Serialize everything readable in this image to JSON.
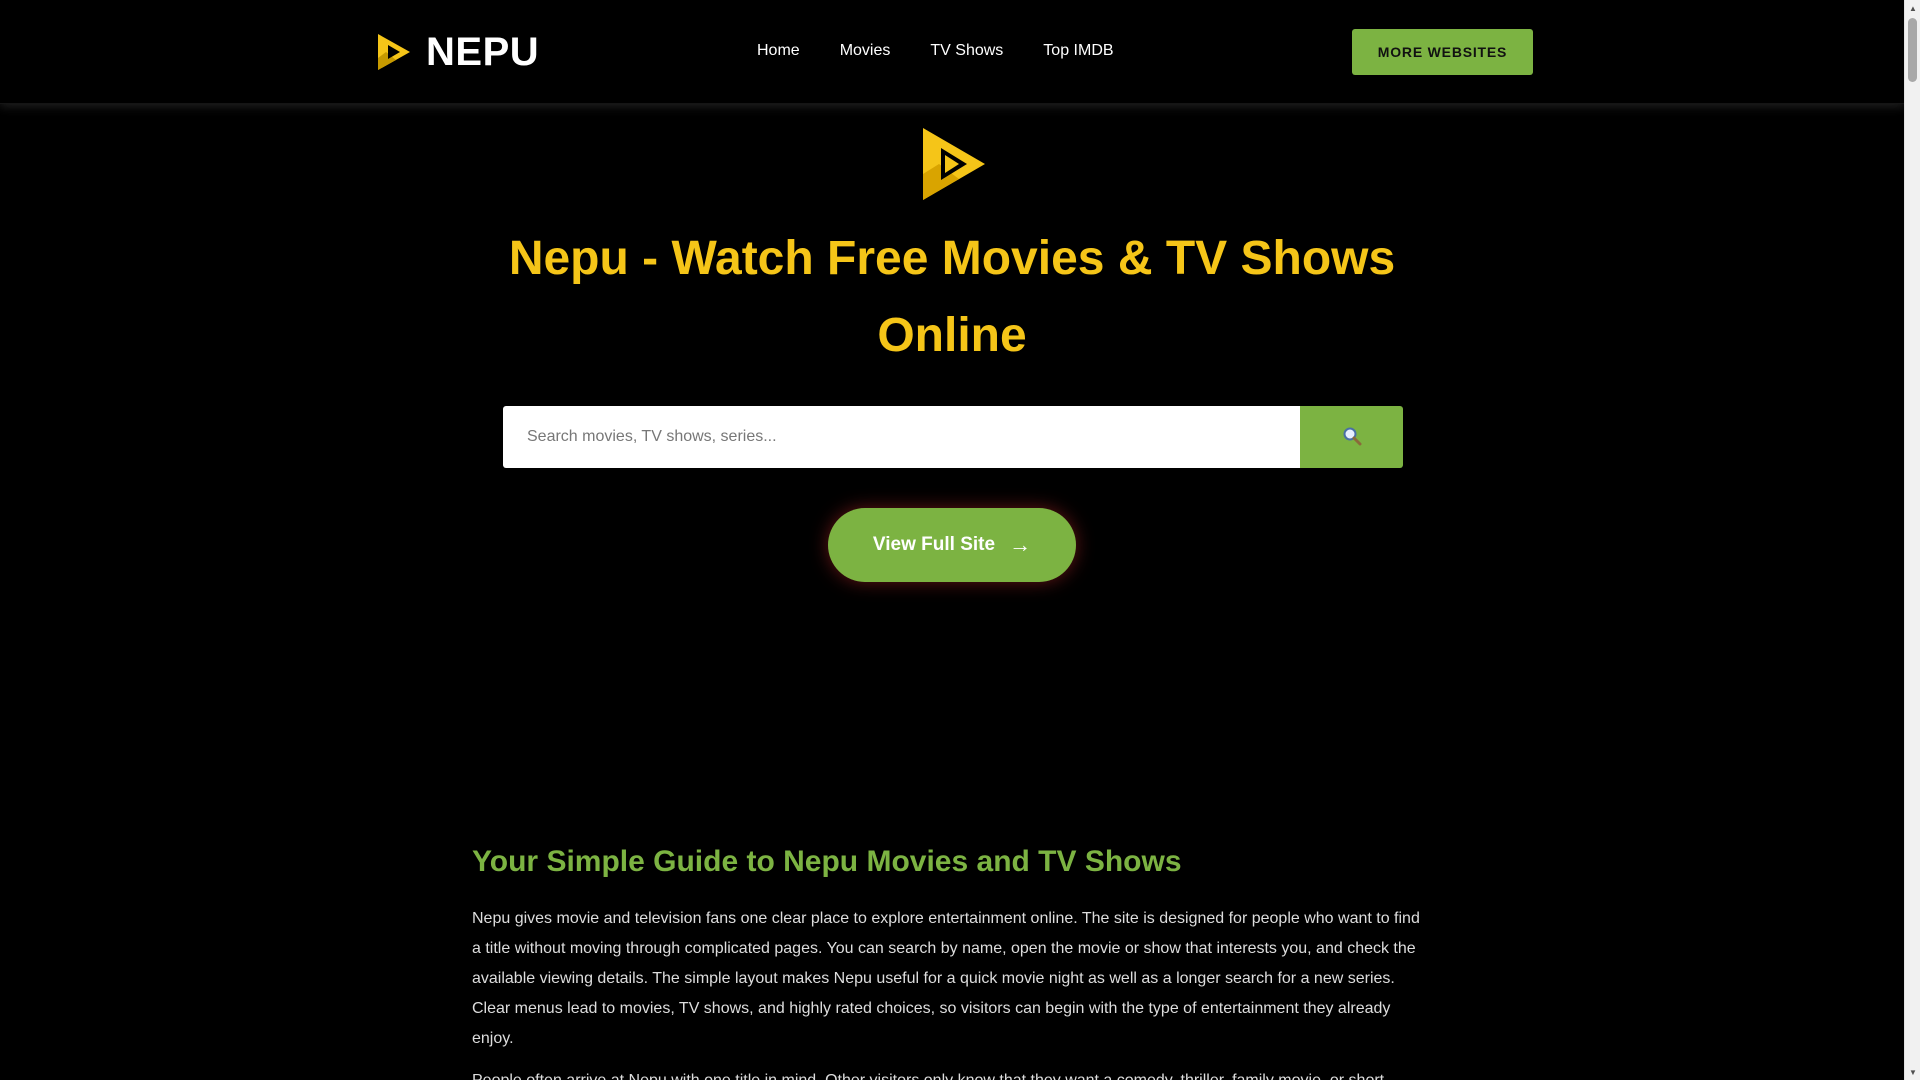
{
  "header": {
    "brand": "NEPU",
    "nav": [
      "Home",
      "Movies",
      "TV Shows",
      "Top IMDB"
    ],
    "more_button": "MORE WEBSITES"
  },
  "hero": {
    "title": "Nepu - Watch Free Movies & TV Shows Online",
    "search_placeholder": "Search movies, TV shows, series...",
    "view_button": "View Full Site",
    "view_arrow": "→"
  },
  "article": {
    "heading": "Your Simple Guide to Nepu Movies and TV Shows",
    "paragraphs": [
      "Nepu gives movie and television fans one clear place to explore entertainment online. The site is designed for people who want to find a title without moving through complicated pages. You can search by name, open the movie or show that interests you, and check the available viewing details. The simple layout makes Nepu useful for a quick movie night as well as a longer search for a new series. Clear menus lead to movies, TV shows, and highly rated choices, so visitors can begin with the type of entertainment they already enjoy.",
      "People often arrive at Nepu with one title in mind. Other visitors only know that they want a comedy, thriller, family movie, or short"
    ]
  },
  "colors": {
    "accent_green": "#7cb342",
    "title_yellow": "#f5c518",
    "background": "#000000"
  },
  "icons": {
    "logo": "play-logo-icon",
    "search": "search-icon",
    "arrow": "arrow-right-icon"
  }
}
